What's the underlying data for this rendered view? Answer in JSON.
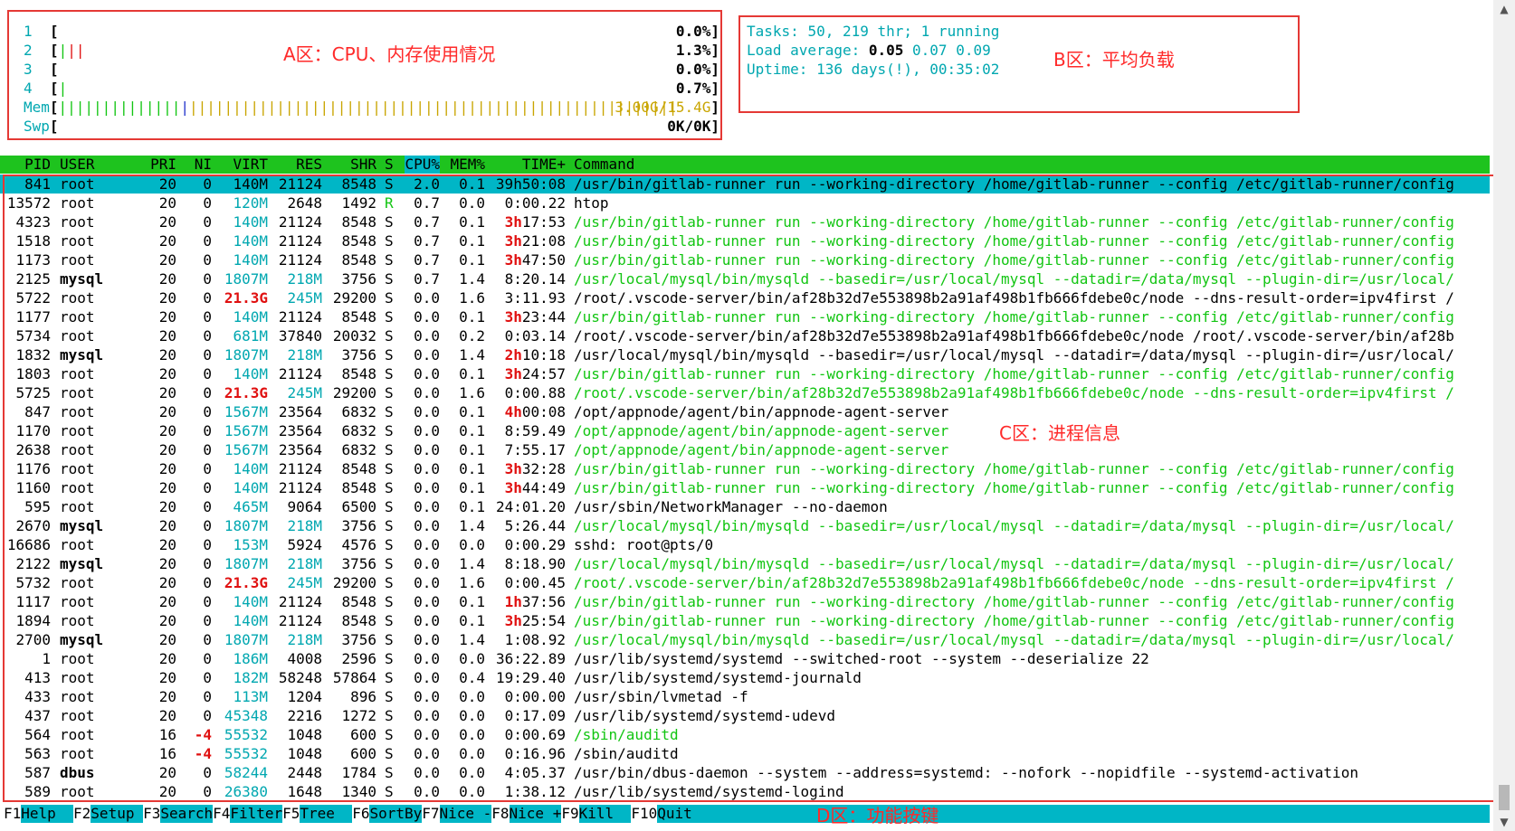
{
  "meters": {
    "cpus": [
      {
        "label": "1",
        "bar": "[",
        "bars_green": "",
        "bars_red": "",
        "value": "0.0%]"
      },
      {
        "label": "2",
        "bar": "[",
        "bars_green": "|",
        "bars_red": "||",
        "value": "1.3%]"
      },
      {
        "label": "3",
        "bar": "[",
        "bars_green": "",
        "bars_red": "",
        "value": "0.0%]"
      },
      {
        "label": "4",
        "bar": "[",
        "bars_green": "|",
        "bars_red": "",
        "value": "0.7%]"
      }
    ],
    "mem": {
      "label": "Mem",
      "open": "[",
      "bars_green": "||||||||||||||",
      "bars_blue": "|",
      "bars_yellow": "||||||||||||||||||||||||||||||||||||||||||||||||||||||||",
      "value": "3.00G/15.4G",
      "close": "]"
    },
    "swp": {
      "label": "Swp",
      "open": "[",
      "value": "0K/0K]"
    }
  },
  "summary": {
    "tasks_label": "Tasks: ",
    "tasks_value": "50, 219 thr; 1 running",
    "load_label": "Load average: ",
    "load_1": "0.05",
    "load_5": "0.07",
    "load_15": "0.09",
    "uptime_label": "Uptime: ",
    "uptime_value": "136 days(!), 00:35:02"
  },
  "annotations": {
    "a": "A区：CPU、内存使用情况",
    "b": "B区：平均负载",
    "c": "C区：进程信息",
    "d": "D区：功能按键"
  },
  "columns": [
    "PID",
    "USER",
    "PRI",
    "NI",
    "VIRT",
    "RES",
    "SHR",
    "S",
    "CPU%",
    "MEM%",
    "TIME+",
    "Command"
  ],
  "processes": [
    {
      "pid": "841",
      "user": "root",
      "pri": "20",
      "ni": "0",
      "virt": "140M",
      "res": "21124",
      "shr": "8548",
      "s": "S",
      "cpu": "2.0",
      "mem": "0.1",
      "time_h": "39h",
      "time_r": "50:08",
      "cmd": "/usr/bin/gitlab-runner run --working-directory /home/gitlab-runner --config /etc/gitlab-runner/config",
      "thread": false,
      "selected": true
    },
    {
      "pid": "13572",
      "user": "root",
      "pri": "20",
      "ni": "0",
      "virt": "120M",
      "res": "2648",
      "shr": "1492",
      "s": "R",
      "cpu": "0.7",
      "mem": "0.0",
      "time_h": "",
      "time_r": "0:00.22",
      "cmd": "htop",
      "thread": false,
      "selected": false
    },
    {
      "pid": "4323",
      "user": "root",
      "pri": "20",
      "ni": "0",
      "virt": "140M",
      "res": "21124",
      "shr": "8548",
      "s": "S",
      "cpu": "0.7",
      "mem": "0.1",
      "time_h": "3h",
      "time_r": "17:53",
      "cmd": "/usr/bin/gitlab-runner run --working-directory /home/gitlab-runner --config /etc/gitlab-runner/config",
      "thread": true,
      "selected": false
    },
    {
      "pid": "1518",
      "user": "root",
      "pri": "20",
      "ni": "0",
      "virt": "140M",
      "res": "21124",
      "shr": "8548",
      "s": "S",
      "cpu": "0.7",
      "mem": "0.1",
      "time_h": "3h",
      "time_r": "21:08",
      "cmd": "/usr/bin/gitlab-runner run --working-directory /home/gitlab-runner --config /etc/gitlab-runner/config",
      "thread": true,
      "selected": false
    },
    {
      "pid": "1173",
      "user": "root",
      "pri": "20",
      "ni": "0",
      "virt": "140M",
      "res": "21124",
      "shr": "8548",
      "s": "S",
      "cpu": "0.7",
      "mem": "0.1",
      "time_h": "3h",
      "time_r": "47:50",
      "cmd": "/usr/bin/gitlab-runner run --working-directory /home/gitlab-runner --config /etc/gitlab-runner/config",
      "thread": true,
      "selected": false
    },
    {
      "pid": "2125",
      "user": "mysql",
      "pri": "20",
      "ni": "0",
      "virt": "1807M",
      "res": "218M",
      "shr": "3756",
      "s": "S",
      "cpu": "0.7",
      "mem": "1.4",
      "time_h": "",
      "time_r": "8:20.14",
      "cmd": "/usr/local/mysql/bin/mysqld --basedir=/usr/local/mysql --datadir=/data/mysql --plugin-dir=/usr/local/",
      "thread": true,
      "selected": false
    },
    {
      "pid": "5722",
      "user": "root",
      "pri": "20",
      "ni": "0",
      "virt": "21.3G",
      "res": "245M",
      "shr": "29200",
      "s": "S",
      "cpu": "0.0",
      "mem": "1.6",
      "time_h": "",
      "time_r": "3:11.93",
      "cmd": "/root/.vscode-server/bin/af28b32d7e553898b2a91af498b1fb666fdebe0c/node --dns-result-order=ipv4first /",
      "thread": false,
      "selected": false
    },
    {
      "pid": "1177",
      "user": "root",
      "pri": "20",
      "ni": "0",
      "virt": "140M",
      "res": "21124",
      "shr": "8548",
      "s": "S",
      "cpu": "0.0",
      "mem": "0.1",
      "time_h": "3h",
      "time_r": "23:44",
      "cmd": "/usr/bin/gitlab-runner run --working-directory /home/gitlab-runner --config /etc/gitlab-runner/config",
      "thread": true,
      "selected": false
    },
    {
      "pid": "5734",
      "user": "root",
      "pri": "20",
      "ni": "0",
      "virt": "681M",
      "res": "37840",
      "shr": "20032",
      "s": "S",
      "cpu": "0.0",
      "mem": "0.2",
      "time_h": "",
      "time_r": "0:03.14",
      "cmd": "/root/.vscode-server/bin/af28b32d7e553898b2a91af498b1fb666fdebe0c/node /root/.vscode-server/bin/af28b",
      "thread": false,
      "selected": false
    },
    {
      "pid": "1832",
      "user": "mysql",
      "pri": "20",
      "ni": "0",
      "virt": "1807M",
      "res": "218M",
      "shr": "3756",
      "s": "S",
      "cpu": "0.0",
      "mem": "1.4",
      "time_h": "2h",
      "time_r": "10:18",
      "cmd": "/usr/local/mysql/bin/mysqld --basedir=/usr/local/mysql --datadir=/data/mysql --plugin-dir=/usr/local/",
      "thread": false,
      "selected": false
    },
    {
      "pid": "1803",
      "user": "root",
      "pri": "20",
      "ni": "0",
      "virt": "140M",
      "res": "21124",
      "shr": "8548",
      "s": "S",
      "cpu": "0.0",
      "mem": "0.1",
      "time_h": "3h",
      "time_r": "24:57",
      "cmd": "/usr/bin/gitlab-runner run --working-directory /home/gitlab-runner --config /etc/gitlab-runner/config",
      "thread": true,
      "selected": false
    },
    {
      "pid": "5725",
      "user": "root",
      "pri": "20",
      "ni": "0",
      "virt": "21.3G",
      "res": "245M",
      "shr": "29200",
      "s": "S",
      "cpu": "0.0",
      "mem": "1.6",
      "time_h": "",
      "time_r": "0:00.88",
      "cmd": "/root/.vscode-server/bin/af28b32d7e553898b2a91af498b1fb666fdebe0c/node --dns-result-order=ipv4first /",
      "thread": true,
      "selected": false
    },
    {
      "pid": "847",
      "user": "root",
      "pri": "20",
      "ni": "0",
      "virt": "1567M",
      "res": "23564",
      "shr": "6832",
      "s": "S",
      "cpu": "0.0",
      "mem": "0.1",
      "time_h": "4h",
      "time_r": "00:08",
      "cmd": "/opt/appnode/agent/bin/appnode-agent-server",
      "thread": false,
      "selected": false
    },
    {
      "pid": "1170",
      "user": "root",
      "pri": "20",
      "ni": "0",
      "virt": "1567M",
      "res": "23564",
      "shr": "6832",
      "s": "S",
      "cpu": "0.0",
      "mem": "0.1",
      "time_h": "",
      "time_r": "8:59.49",
      "cmd": "/opt/appnode/agent/bin/appnode-agent-server",
      "thread": true,
      "selected": false
    },
    {
      "pid": "2638",
      "user": "root",
      "pri": "20",
      "ni": "0",
      "virt": "1567M",
      "res": "23564",
      "shr": "6832",
      "s": "S",
      "cpu": "0.0",
      "mem": "0.1",
      "time_h": "",
      "time_r": "7:55.17",
      "cmd": "/opt/appnode/agent/bin/appnode-agent-server",
      "thread": true,
      "selected": false
    },
    {
      "pid": "1176",
      "user": "root",
      "pri": "20",
      "ni": "0",
      "virt": "140M",
      "res": "21124",
      "shr": "8548",
      "s": "S",
      "cpu": "0.0",
      "mem": "0.1",
      "time_h": "3h",
      "time_r": "32:28",
      "cmd": "/usr/bin/gitlab-runner run --working-directory /home/gitlab-runner --config /etc/gitlab-runner/config",
      "thread": true,
      "selected": false
    },
    {
      "pid": "1160",
      "user": "root",
      "pri": "20",
      "ni": "0",
      "virt": "140M",
      "res": "21124",
      "shr": "8548",
      "s": "S",
      "cpu": "0.0",
      "mem": "0.1",
      "time_h": "3h",
      "time_r": "44:49",
      "cmd": "/usr/bin/gitlab-runner run --working-directory /home/gitlab-runner --config /etc/gitlab-runner/config",
      "thread": true,
      "selected": false
    },
    {
      "pid": "595",
      "user": "root",
      "pri": "20",
      "ni": "0",
      "virt": "465M",
      "res": "9064",
      "shr": "6500",
      "s": "S",
      "cpu": "0.0",
      "mem": "0.1",
      "time_h": "",
      "time_r": "24:01.20",
      "cmd": "/usr/sbin/NetworkManager --no-daemon",
      "thread": false,
      "selected": false
    },
    {
      "pid": "2670",
      "user": "mysql",
      "pri": "20",
      "ni": "0",
      "virt": "1807M",
      "res": "218M",
      "shr": "3756",
      "s": "S",
      "cpu": "0.0",
      "mem": "1.4",
      "time_h": "",
      "time_r": "5:26.44",
      "cmd": "/usr/local/mysql/bin/mysqld --basedir=/usr/local/mysql --datadir=/data/mysql --plugin-dir=/usr/local/",
      "thread": true,
      "selected": false
    },
    {
      "pid": "16686",
      "user": "root",
      "pri": "20",
      "ni": "0",
      "virt": "153M",
      "res": "5924",
      "shr": "4576",
      "s": "S",
      "cpu": "0.0",
      "mem": "0.0",
      "time_h": "",
      "time_r": "0:00.29",
      "cmd": "sshd: root@pts/0",
      "thread": false,
      "selected": false
    },
    {
      "pid": "2122",
      "user": "mysql",
      "pri": "20",
      "ni": "0",
      "virt": "1807M",
      "res": "218M",
      "shr": "3756",
      "s": "S",
      "cpu": "0.0",
      "mem": "1.4",
      "time_h": "",
      "time_r": "8:18.90",
      "cmd": "/usr/local/mysql/bin/mysqld --basedir=/usr/local/mysql --datadir=/data/mysql --plugin-dir=/usr/local/",
      "thread": true,
      "selected": false
    },
    {
      "pid": "5732",
      "user": "root",
      "pri": "20",
      "ni": "0",
      "virt": "21.3G",
      "res": "245M",
      "shr": "29200",
      "s": "S",
      "cpu": "0.0",
      "mem": "1.6",
      "time_h": "",
      "time_r": "0:00.45",
      "cmd": "/root/.vscode-server/bin/af28b32d7e553898b2a91af498b1fb666fdebe0c/node --dns-result-order=ipv4first /",
      "thread": true,
      "selected": false
    },
    {
      "pid": "1117",
      "user": "root",
      "pri": "20",
      "ni": "0",
      "virt": "140M",
      "res": "21124",
      "shr": "8548",
      "s": "S",
      "cpu": "0.0",
      "mem": "0.1",
      "time_h": "1h",
      "time_r": "37:56",
      "cmd": "/usr/bin/gitlab-runner run --working-directory /home/gitlab-runner --config /etc/gitlab-runner/config",
      "thread": true,
      "selected": false
    },
    {
      "pid": "1894",
      "user": "root",
      "pri": "20",
      "ni": "0",
      "virt": "140M",
      "res": "21124",
      "shr": "8548",
      "s": "S",
      "cpu": "0.0",
      "mem": "0.1",
      "time_h": "3h",
      "time_r": "25:54",
      "cmd": "/usr/bin/gitlab-runner run --working-directory /home/gitlab-runner --config /etc/gitlab-runner/config",
      "thread": true,
      "selected": false
    },
    {
      "pid": "2700",
      "user": "mysql",
      "pri": "20",
      "ni": "0",
      "virt": "1807M",
      "res": "218M",
      "shr": "3756",
      "s": "S",
      "cpu": "0.0",
      "mem": "1.4",
      "time_h": "",
      "time_r": "1:08.92",
      "cmd": "/usr/local/mysql/bin/mysqld --basedir=/usr/local/mysql --datadir=/data/mysql --plugin-dir=/usr/local/",
      "thread": true,
      "selected": false
    },
    {
      "pid": "1",
      "user": "root",
      "pri": "20",
      "ni": "0",
      "virt": "186M",
      "res": "4008",
      "shr": "2596",
      "s": "S",
      "cpu": "0.0",
      "mem": "0.0",
      "time_h": "",
      "time_r": "36:22.89",
      "cmd": "/usr/lib/systemd/systemd --switched-root --system --deserialize 22",
      "thread": false,
      "selected": false
    },
    {
      "pid": "413",
      "user": "root",
      "pri": "20",
      "ni": "0",
      "virt": "182M",
      "res": "58248",
      "shr": "57864",
      "s": "S",
      "cpu": "0.0",
      "mem": "0.4",
      "time_h": "",
      "time_r": "19:29.40",
      "cmd": "/usr/lib/systemd/systemd-journald",
      "thread": false,
      "selected": false
    },
    {
      "pid": "433",
      "user": "root",
      "pri": "20",
      "ni": "0",
      "virt": "113M",
      "res": "1204",
      "shr": "896",
      "s": "S",
      "cpu": "0.0",
      "mem": "0.0",
      "time_h": "",
      "time_r": "0:00.00",
      "cmd": "/usr/sbin/lvmetad -f",
      "thread": false,
      "selected": false
    },
    {
      "pid": "437",
      "user": "root",
      "pri": "20",
      "ni": "0",
      "virt": "45348",
      "res": "2216",
      "shr": "1272",
      "s": "S",
      "cpu": "0.0",
      "mem": "0.0",
      "time_h": "",
      "time_r": "0:17.09",
      "cmd": "/usr/lib/systemd/systemd-udevd",
      "thread": false,
      "selected": false
    },
    {
      "pid": "564",
      "user": "root",
      "pri": "16",
      "ni": "-4",
      "virt": "55532",
      "res": "1048",
      "shr": "600",
      "s": "S",
      "cpu": "0.0",
      "mem": "0.0",
      "time_h": "",
      "time_r": "0:00.69",
      "cmd": "/sbin/auditd",
      "thread": true,
      "selected": false
    },
    {
      "pid": "563",
      "user": "root",
      "pri": "16",
      "ni": "-4",
      "virt": "55532",
      "res": "1048",
      "shr": "600",
      "s": "S",
      "cpu": "0.0",
      "mem": "0.0",
      "time_h": "",
      "time_r": "0:16.96",
      "cmd": "/sbin/auditd",
      "thread": false,
      "selected": false
    },
    {
      "pid": "587",
      "user": "dbus",
      "pri": "20",
      "ni": "0",
      "virt": "58244",
      "res": "2448",
      "shr": "1784",
      "s": "S",
      "cpu": "0.0",
      "mem": "0.0",
      "time_h": "",
      "time_r": "4:05.37",
      "cmd": "/usr/bin/dbus-daemon --system --address=systemd: --nofork --nopidfile --systemd-activation",
      "thread": false,
      "selected": false
    },
    {
      "pid": "589",
      "user": "root",
      "pri": "20",
      "ni": "0",
      "virt": "26380",
      "res": "1648",
      "shr": "1340",
      "s": "S",
      "cpu": "0.0",
      "mem": "0.0",
      "time_h": "",
      "time_r": "1:38.12",
      "cmd": "/usr/lib/systemd/systemd-logind",
      "thread": false,
      "selected": false
    }
  ],
  "function_keys": [
    {
      "key": "F1",
      "label": "Help  "
    },
    {
      "key": "F2",
      "label": "Setup "
    },
    {
      "key": "F3",
      "label": "Search"
    },
    {
      "key": "F4",
      "label": "Filter"
    },
    {
      "key": "F5",
      "label": "Tree  "
    },
    {
      "key": "F6",
      "label": "SortBy"
    },
    {
      "key": "F7",
      "label": "Nice -"
    },
    {
      "key": "F8",
      "label": "Nice +"
    },
    {
      "key": "F9",
      "label": "Kill  "
    },
    {
      "key": "F10",
      "label": "Quit  "
    }
  ],
  "colors": {
    "header_bg": "#1ec31e",
    "selected_bg": "#00b6c6",
    "thread_text": "#12c512",
    "annotation": "#ff2a2a"
  }
}
